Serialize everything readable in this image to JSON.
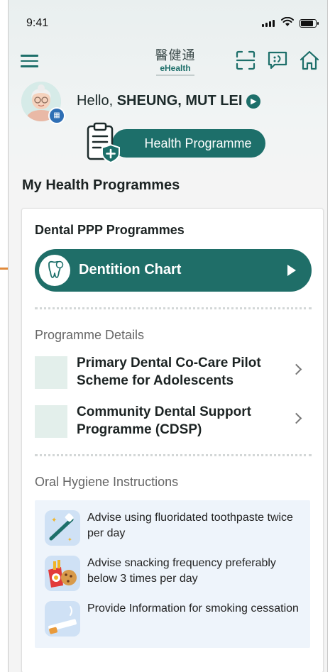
{
  "status_bar": {
    "time": "9:41"
  },
  "header": {
    "logo_cn": "醫健通",
    "logo_en": "eHealth"
  },
  "greeting": {
    "prefix": "Hello, ",
    "name": "SHEUNG, MUT LEI"
  },
  "health_programme_button": "Health Programme",
  "section_title": "My Health Programmes",
  "card": {
    "title": "Dental PPP Programmes",
    "dentition_chart_label": "Dentition Chart",
    "programme_details_title": "Programme Details",
    "programmes": [
      {
        "label": "Primary Dental Co-Care Pilot Scheme for Adolescents"
      },
      {
        "label": "Community Dental Support Programme (CDSP)"
      }
    ],
    "oral_hygiene_title": "Oral Hygiene Instructions",
    "tips": [
      {
        "text": "Advise using fluoridated toothpaste twice per day",
        "icon": "toothbrush-icon"
      },
      {
        "text": "Advise snacking frequency preferably below 3 times per day",
        "icon": "snacks-icon"
      },
      {
        "text": "Provide Information for smoking cessation",
        "icon": "cigarette-icon"
      }
    ]
  },
  "colors": {
    "primary": "#1d6f6a",
    "tips_bg": "#eef4fb",
    "thumb_bg": "#e3efeb"
  }
}
